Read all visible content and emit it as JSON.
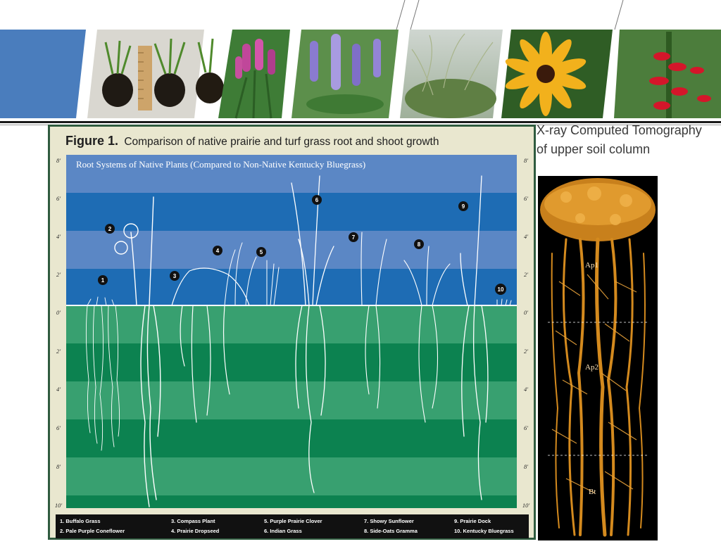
{
  "banner": {
    "accent_color": "#4a7dbd",
    "photos": [
      "root-cores-photo",
      "blazing-star-photo",
      "lupine-photo",
      "grass-photo",
      "black-eyed-susan-photo",
      "cardinal-flower-photo"
    ]
  },
  "figure": {
    "label": "Figure 1.",
    "title": "Comparison of native prairie and turf grass root and shoot growth",
    "sky_label": "Root Systems of Native Plants (Compared to Non-Native Kentucky Bluegrass)",
    "scale_left": [
      "8'",
      "6'",
      "4'",
      "2'",
      "0'",
      "2'",
      "4'",
      "6'",
      "8'",
      "10'"
    ],
    "scale_right": [
      "8'",
      "6'",
      "4'",
      "2'",
      "0'",
      "2'",
      "4'",
      "6'",
      "8'",
      "10'"
    ],
    "markers": [
      "1",
      "2",
      "3",
      "4",
      "5",
      "6",
      "7",
      "8",
      "9",
      "10"
    ],
    "legend": [
      "1. Buffalo Grass",
      "2. Pale Purple Coneflower",
      "3. Compass Plant",
      "4. Prairie Dropseed",
      "5. Purple Prairie Clover",
      "6. Indian Grass",
      "7. Showy Sunflower",
      "8. Side-Oats Gramma",
      "9. Prairie Dock",
      "10. Kentucky Bluegrass"
    ],
    "colors": {
      "sky_light": "#5b87c5",
      "sky_dark": "#1e6cb4",
      "soil_light": "#38a070",
      "soil_dark": "#0c8250",
      "frame": "#2f5b3f"
    }
  },
  "xray": {
    "title": "X-ray Computed Tomography of upper soil column",
    "horizons": [
      "Ap1",
      "Ap2",
      "Bt"
    ],
    "root_color": "#d48a1e"
  }
}
